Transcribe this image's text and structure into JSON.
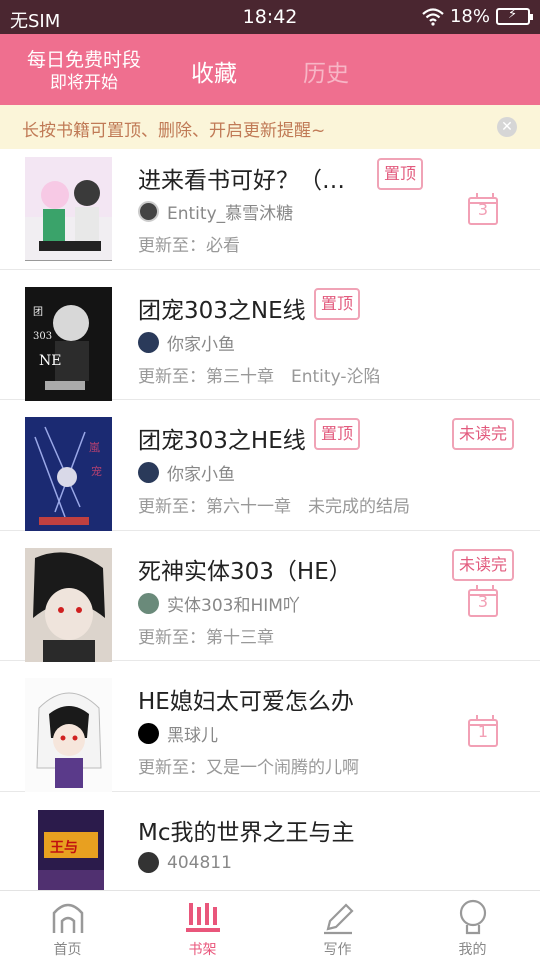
{
  "status_bar": {
    "carrier": "无SIM",
    "time": "18:42",
    "battery": "18%"
  },
  "header": {
    "free_line1": "每日免费时段",
    "free_line2": "即将开始",
    "tab_favorites": "收藏",
    "tab_history": "历史"
  },
  "tip": {
    "text": "长按书籍可置顶、删除、开启更新提醒~"
  },
  "books": [
    {
      "title": "进来看书可好？（…",
      "author": "Entity_慕雪沐糖",
      "update": "更新至：必看",
      "badge_pin": "置顶",
      "badge_unread": "",
      "calendar": "3"
    },
    {
      "title": "团宠303之NE线",
      "author": "你家小鱼",
      "update": "更新至：第三十章　Entity-沦陷",
      "badge_pin": "置顶",
      "badge_unread": "",
      "calendar": ""
    },
    {
      "title": "团宠303之HE线",
      "author": "你家小鱼",
      "update": "更新至：第六十一章　未完成的结局",
      "badge_pin": "置顶",
      "badge_unread": "未读完",
      "calendar": ""
    },
    {
      "title": "死神实体303（HE）",
      "author": "实体303和HIM吖",
      "update": "更新至：第十三章",
      "badge_pin": "",
      "badge_unread": "未读完",
      "calendar": "3"
    },
    {
      "title": "HE媳妇太可爱怎么办",
      "author": "黑球儿",
      "update": "更新至：又是一个闹腾的儿啊",
      "badge_pin": "",
      "badge_unread": "",
      "calendar": "1"
    },
    {
      "title": "Mc我的世界之王与主",
      "author": "404811",
      "update": "",
      "badge_pin": "",
      "badge_unread": "",
      "calendar": ""
    }
  ],
  "nav": {
    "home": "首页",
    "shelf": "书架",
    "write": "写作",
    "mine": "我的"
  },
  "colors": {
    "header": "#ef6f8f",
    "accent": "#e9567b",
    "status_bar": "#4a2630",
    "tip_bg": "#fbf5d9"
  }
}
